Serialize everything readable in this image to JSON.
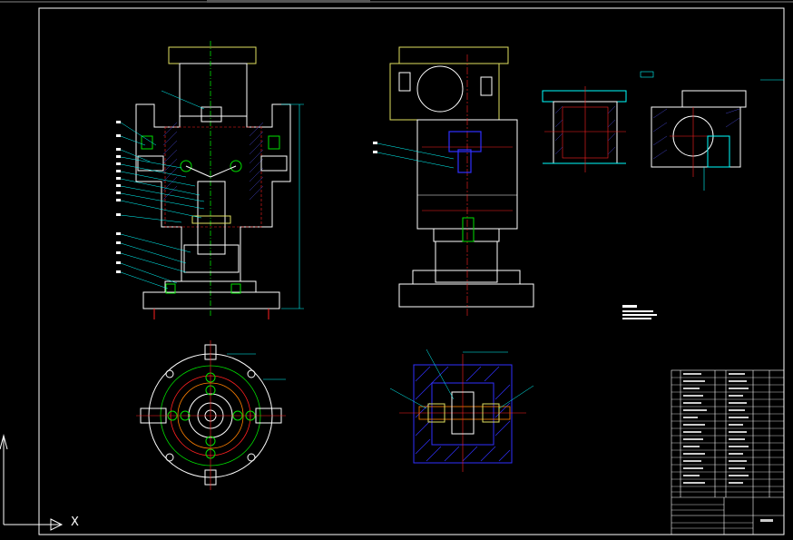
{
  "view": {
    "background": "#000000",
    "ucs_axis_label": "X"
  },
  "colors": {
    "outline": "#ffffff",
    "center_line": "#ff2020",
    "green_line": "#00e000",
    "cyan_leader": "#00ffff",
    "yellow_body": "#e0e060",
    "blue_part": "#3030ff",
    "hatch": "#4040c0",
    "orange": "#ff8000"
  },
  "icons": [
    "ucs-axis-icon"
  ]
}
